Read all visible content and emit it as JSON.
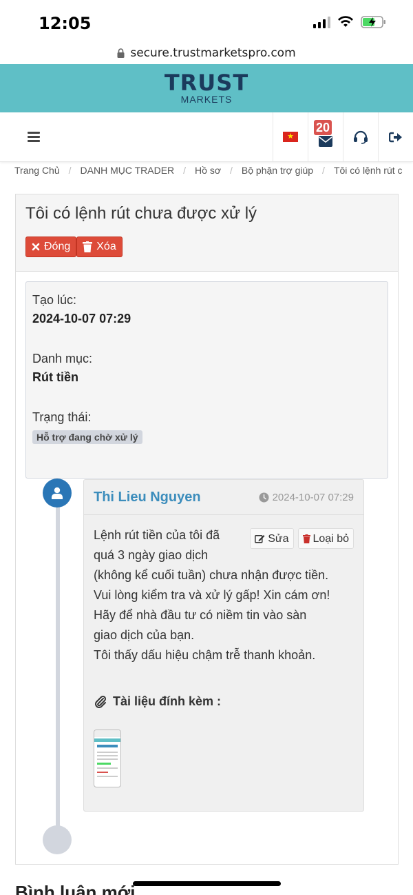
{
  "status_bar": {
    "time": "12:05"
  },
  "browser": {
    "url": "secure.trustmarketspro.com"
  },
  "brand": {
    "name": "TRUST",
    "sub": "MARKETS"
  },
  "nav": {
    "notification_count": "20"
  },
  "breadcrumb": [
    "Trang Chủ",
    "DANH MỤC TRADER",
    "Hồ sơ",
    "Bộ phận trợ giúp",
    "Tôi có lệnh rút c"
  ],
  "ticket": {
    "title": "Tôi có lệnh rút chưa được xử lý",
    "close_label": "Đóng",
    "delete_label": "Xóa",
    "created_label": "Tạo lúc:",
    "created_value": "2024-10-07 07:29",
    "category_label": "Danh mục:",
    "category_value": "Rút tiền",
    "status_label": "Trạng thái:",
    "status_value": "Hỗ trợ đang chờ xử lý"
  },
  "comment": {
    "author": "Thi Lieu Nguyen",
    "time": "2024-10-07 07:29",
    "edit_label": "Sửa",
    "remove_label": "Loại bỏ",
    "lines": [
      "Lệnh rút tiền của tôi đã",
      "quá 3 ngày giao dịch",
      "(không kể cuối tuần) chưa nhận được tiền.",
      "Vui lòng kiểm tra và xử lý gấp! Xin cám ơn!",
      "Hãy để nhà đầu tư có niềm tin vào sàn",
      "giao dịch của bạn.",
      "Tôi thấy dấu hiệu chậm trễ thanh khoản."
    ],
    "attachments_label": "Tài liệu đính kèm :"
  },
  "footer": {
    "new_comment_heading": "Bình luận mới"
  },
  "colors": {
    "brand_bar": "#5fbfc6",
    "danger": "#dd4b39",
    "link": "#3c8dbc"
  }
}
